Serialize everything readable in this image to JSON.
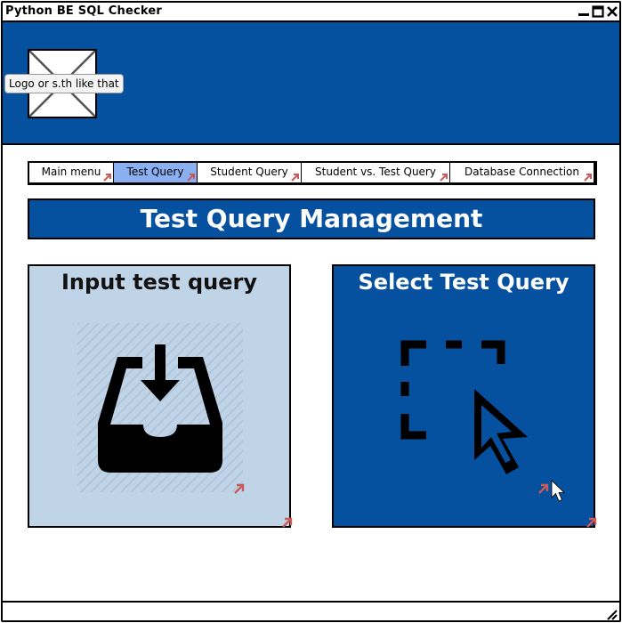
{
  "window": {
    "title": "Python BE SQL Checker"
  },
  "header": {
    "logo_label": "Logo or s.th like that"
  },
  "nav": {
    "tabs": [
      {
        "label": "Main menu",
        "active": false
      },
      {
        "label": "Test Query",
        "active": true
      },
      {
        "label": "Student Query",
        "active": false
      },
      {
        "label": "Student vs. Test Query",
        "active": false
      },
      {
        "label": "Database Connection",
        "active": false
      }
    ]
  },
  "page": {
    "title": "Test Query Management"
  },
  "cards": {
    "input": {
      "title": "Input test query",
      "icon": "inbox-download-icon"
    },
    "select": {
      "title": "Select Test Query",
      "icon": "select-cursor-icon"
    }
  },
  "colors": {
    "primary_blue": "#0650a0",
    "active_tab": "#8ab0f2",
    "card_light": "#c0d4e8",
    "link_arrow": "#c85a5a"
  }
}
